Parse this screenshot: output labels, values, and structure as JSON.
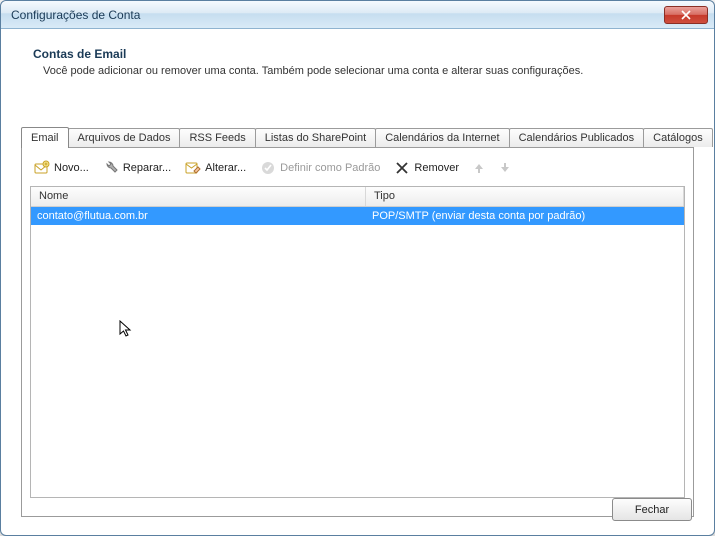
{
  "window": {
    "title": "Configurações de Conta"
  },
  "header": {
    "title": "Contas de Email",
    "description": "Você pode adicionar ou remover uma conta. Também pode selecionar uma conta e alterar suas configurações."
  },
  "tabs": {
    "items": [
      {
        "label": "Email",
        "active": true
      },
      {
        "label": "Arquivos de Dados"
      },
      {
        "label": "RSS Feeds"
      },
      {
        "label": "Listas do SharePoint"
      },
      {
        "label": "Calendários da Internet"
      },
      {
        "label": "Calendários Publicados"
      },
      {
        "label": "Catálogos"
      }
    ]
  },
  "toolbar": {
    "new": "Novo...",
    "repair": "Reparar...",
    "change": "Alterar...",
    "set_default": "Definir como Padrão",
    "remove": "Remover"
  },
  "list": {
    "columns": {
      "name": "Nome",
      "type": "Tipo"
    },
    "rows": [
      {
        "name": "contato@flutua.com.br",
        "type": "POP/SMTP (enviar desta conta por padrão)",
        "selected": true
      }
    ]
  },
  "footer": {
    "close": "Fechar"
  }
}
